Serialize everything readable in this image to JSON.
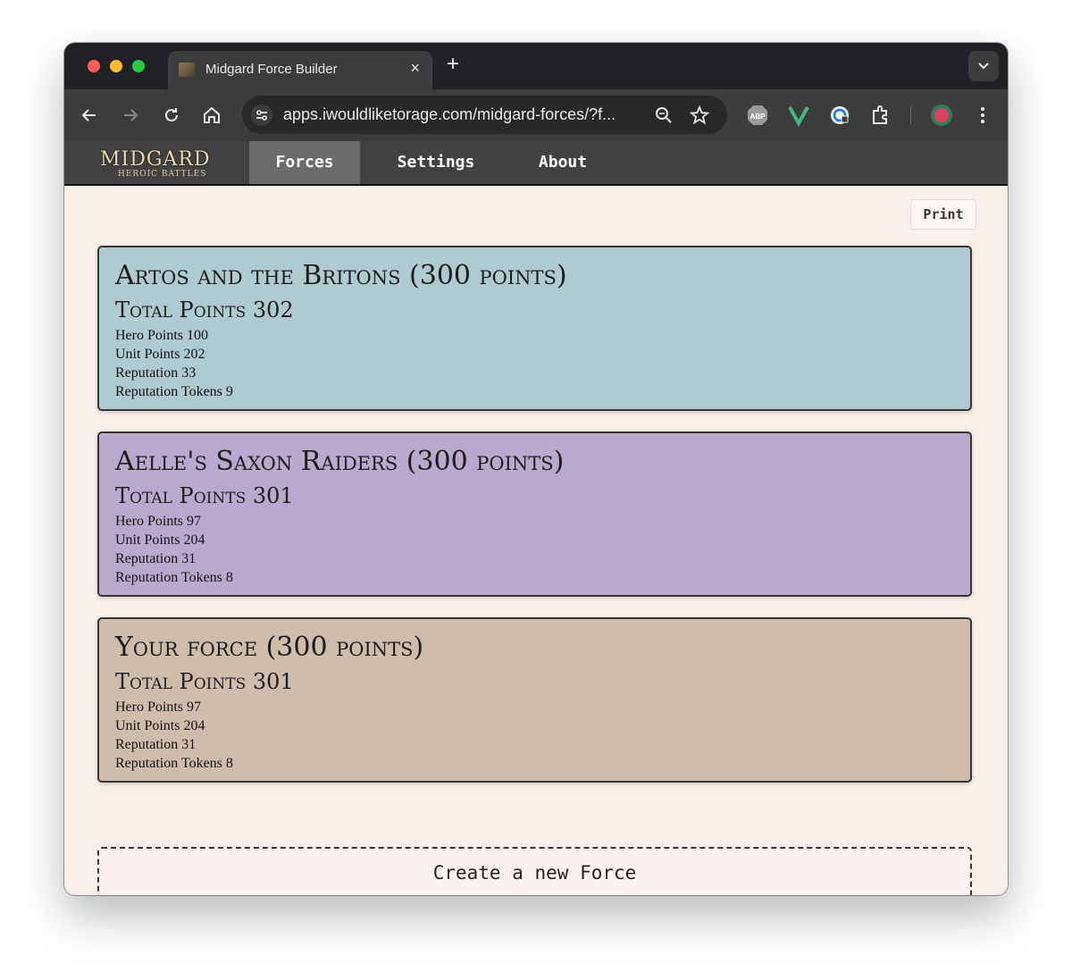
{
  "browser": {
    "tab_title": "Midgard Force Builder",
    "close_glyph": "×",
    "newtab_glyph": "+",
    "url": "apps.iwouldliketorage.com/midgard-forces/?f..."
  },
  "app": {
    "logo_text": "MIDGARD",
    "logo_sub": "HEROIC BATTLES",
    "nav": {
      "forces": "Forces",
      "settings": "Settings",
      "about": "About"
    },
    "print_label": "Print",
    "create_label": "Create a new Force"
  },
  "forces": [
    {
      "title": "Artos and the Britons (300 points)",
      "total": "Total Points 302",
      "hero": "Hero Points 100",
      "unit": "Unit Points 202",
      "reputation": "Reputation 33",
      "tokens": "Reputation Tokens 9",
      "color": "#adcbd0"
    },
    {
      "title": "Aelle's Saxon Raiders (300 points)",
      "total": "Total Points 301",
      "hero": "Hero Points 97",
      "unit": "Unit Points 204",
      "reputation": "Reputation 31",
      "tokens": "Reputation Tokens 8",
      "color": "#b9a9cf"
    },
    {
      "title": "Your force (300 points)",
      "total": "Total Points 301",
      "hero": "Hero Points 97",
      "unit": "Unit Points 204",
      "reputation": "Reputation 31",
      "tokens": "Reputation Tokens 8",
      "color": "#d0bcab"
    }
  ]
}
